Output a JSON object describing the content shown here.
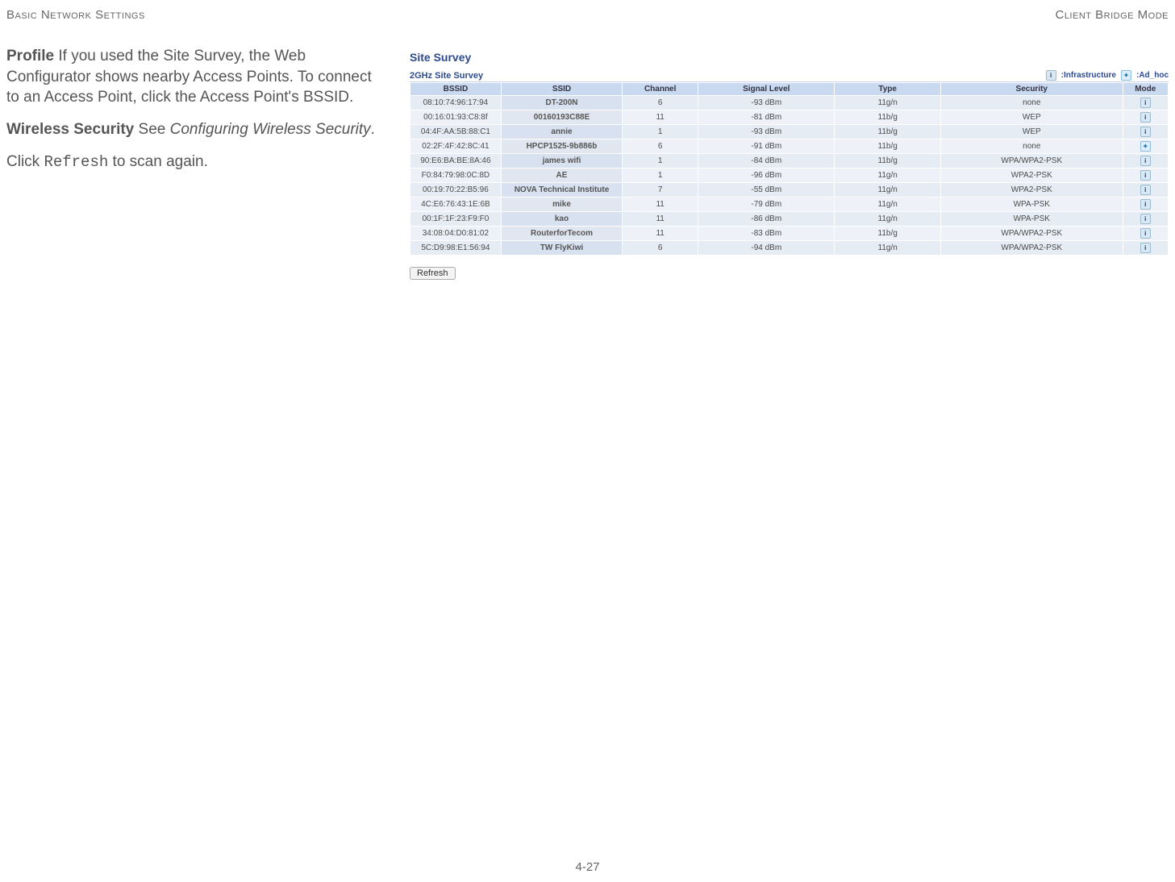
{
  "header": {
    "left": "Basic Network Settings",
    "right": "Client Bridge Mode"
  },
  "left": {
    "profile_label": "Profile",
    "profile_text": "  If you used the Site Survey, the Web Configurator shows nearby Access Points. To connect to an Access Point, click the Access Point's BSSID.",
    "ws_label": "Wireless Security",
    "ws_text_1": "  See ",
    "ws_text_em": "Configuring Wireless Security",
    "ws_text_2": ".",
    "click_1": "Click ",
    "click_mono": "Refresh",
    "click_2": " to scan again."
  },
  "survey": {
    "title": "Site Survey",
    "subtitle": "2GHz Site Survey",
    "legend_infra": ":Infrastructure",
    "legend_adhoc": ":Ad_hoc",
    "cols": {
      "bssid": "BSSID",
      "ssid": "SSID",
      "channel": "Channel",
      "signal": "Signal Level",
      "type": "Type",
      "security": "Security",
      "mode": "Mode"
    },
    "rows": [
      {
        "bssid": "08:10:74:96:17:94",
        "ssid": "DT-200N",
        "ch": "6",
        "sig": "-93 dBm",
        "type": "11g/n",
        "sec": "none",
        "mode": "i"
      },
      {
        "bssid": "00:16:01:93:C8:8f",
        "ssid": "00160193C88E",
        "ch": "11",
        "sig": "-81 dBm",
        "type": "11b/g",
        "sec": "WEP",
        "mode": "i"
      },
      {
        "bssid": "04:4F:AA:5B:88:C1",
        "ssid": "annie",
        "ch": "1",
        "sig": "-93 dBm",
        "type": "11b/g",
        "sec": "WEP",
        "mode": "i"
      },
      {
        "bssid": "02:2F:4F:42:8C:41",
        "ssid": "HPCP1525-9b886b",
        "ch": "6",
        "sig": "-91 dBm",
        "type": "11b/g",
        "sec": "none",
        "mode": "a"
      },
      {
        "bssid": "90:E6:BA:BE:8A:46",
        "ssid": "james wifi",
        "ch": "1",
        "sig": "-84 dBm",
        "type": "11b/g",
        "sec": "WPA/WPA2-PSK",
        "mode": "i"
      },
      {
        "bssid": "F0:84:79:98:0C:8D",
        "ssid": "AE",
        "ch": "1",
        "sig": "-96 dBm",
        "type": "11g/n",
        "sec": "WPA2-PSK",
        "mode": "i"
      },
      {
        "bssid": "00:19:70:22:B5:96",
        "ssid": "NOVA Technical Institute",
        "ch": "7",
        "sig": "-55 dBm",
        "type": "11g/n",
        "sec": "WPA2-PSK",
        "mode": "i"
      },
      {
        "bssid": "4C:E6:76:43:1E:6B",
        "ssid": "mike",
        "ch": "11",
        "sig": "-79 dBm",
        "type": "11g/n",
        "sec": "WPA-PSK",
        "mode": "i"
      },
      {
        "bssid": "00:1F:1F:23:F9:F0",
        "ssid": "kao",
        "ch": "11",
        "sig": "-86 dBm",
        "type": "11g/n",
        "sec": "WPA-PSK",
        "mode": "i"
      },
      {
        "bssid": "34:08:04:D0:81:02",
        "ssid": "RouterforTecom",
        "ch": "11",
        "sig": "-83 dBm",
        "type": "11b/g",
        "sec": "WPA/WPA2-PSK",
        "mode": "i"
      },
      {
        "bssid": "5C:D9:98:E1:56:94",
        "ssid": "TW FlyKiwi",
        "ch": "6",
        "sig": "-94 dBm",
        "type": "11g/n",
        "sec": "WPA/WPA2-PSK",
        "mode": "i"
      }
    ],
    "refresh": "Refresh"
  },
  "footer": "4-27"
}
